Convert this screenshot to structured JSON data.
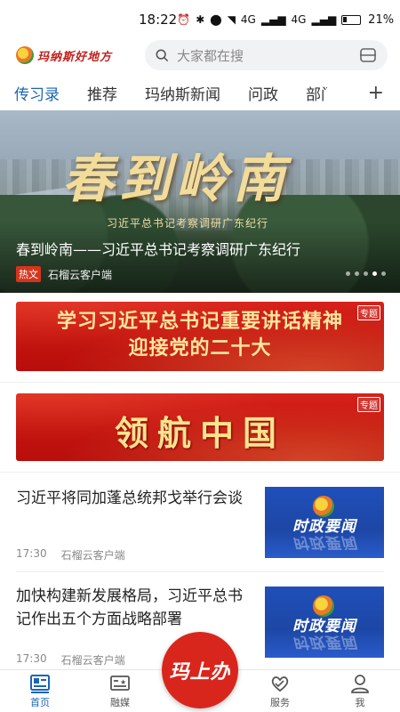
{
  "status_bar": {
    "time": "18:22",
    "network": "4G",
    "network2": "4G",
    "battery": "21%"
  },
  "header": {
    "logo_text": "玛纳斯好地方",
    "search_placeholder": "大家都在搜"
  },
  "tabs": [
    {
      "label": "传习录",
      "active": true
    },
    {
      "label": "推荐"
    },
    {
      "label": "玛纳斯新闻"
    },
    {
      "label": "问政"
    },
    {
      "label": "部门"
    }
  ],
  "hero": {
    "calligraphy": "春到岭南",
    "subtitle": "习近平总书记考察调研广东纪行",
    "title": "春到岭南——习近平总书记考察调研广东纪行",
    "badge": "热文",
    "source": "石榴云客户端"
  },
  "banners": [
    {
      "lines": [
        "学习习近平总书记重要讲话精神",
        "迎接党的二十大"
      ],
      "tag": "专题"
    },
    {
      "text": "领航中国",
      "tag": "专题"
    }
  ],
  "news": [
    {
      "title": "习近平将同加蓬总统邦戈举行会谈",
      "time": "17:30",
      "source": "石榴云客户端",
      "thumb_text": "时政要闻"
    },
    {
      "title": "加快构建新发展格局，习近平总书记作出五个方面战略部署",
      "time": "17:30",
      "source": "石榴云客户端",
      "thumb_text": "时政要闻"
    }
  ],
  "bottom_nav": {
    "home": "首页",
    "media": "融媒",
    "center": "玛上办",
    "service": "服务",
    "me": "我"
  },
  "colors": {
    "accent": "#1a66b5",
    "red": "#d4351c"
  }
}
